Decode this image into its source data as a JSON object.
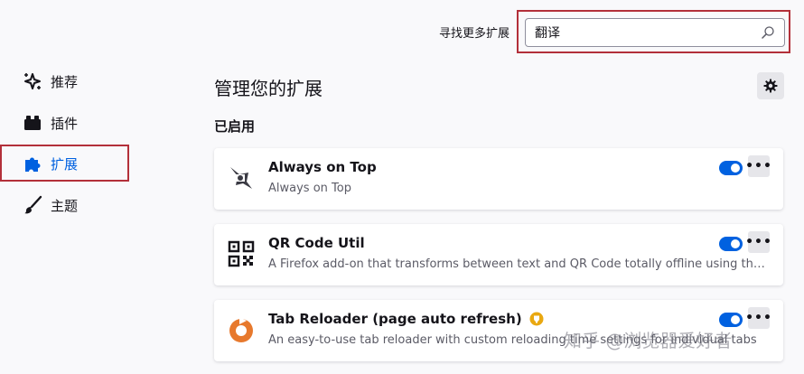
{
  "search": {
    "label": "寻找更多扩展",
    "value": "翻译"
  },
  "sidebar": {
    "items": [
      {
        "label": "推荐",
        "icon": "sparkle-icon"
      },
      {
        "label": "插件",
        "icon": "plugin-icon"
      },
      {
        "label": "扩展",
        "icon": "puzzle-icon"
      },
      {
        "label": "主题",
        "icon": "brush-icon"
      }
    ],
    "active": "扩展"
  },
  "main": {
    "title": "管理您的扩展",
    "section_enabled": "已启用",
    "extensions": [
      {
        "name": "Always on Top",
        "description": "Always on Top",
        "enabled": true,
        "icon": "pin-icon",
        "more": "•••"
      },
      {
        "name": "QR Code Util",
        "description": "A Firefox add-on that transforms between text and QR Code totally offline using the ...",
        "enabled": true,
        "icon": "qr-code-icon",
        "more": "•••"
      },
      {
        "name": "Tab Reloader (page auto refresh)",
        "description": "An easy-to-use tab reloader with custom reloading time settings for individual tabs",
        "enabled": true,
        "icon": "reload-icon",
        "more": "•••",
        "recommended_badge": true
      }
    ]
  },
  "watermark": "知乎 @浏览器爱好者",
  "colors": {
    "accent": "#0061e0",
    "highlight_frame": "#b3303a",
    "background": "#f9f9fb",
    "reload_orange": "#e7792d",
    "badge_gold": "#e9a811"
  }
}
